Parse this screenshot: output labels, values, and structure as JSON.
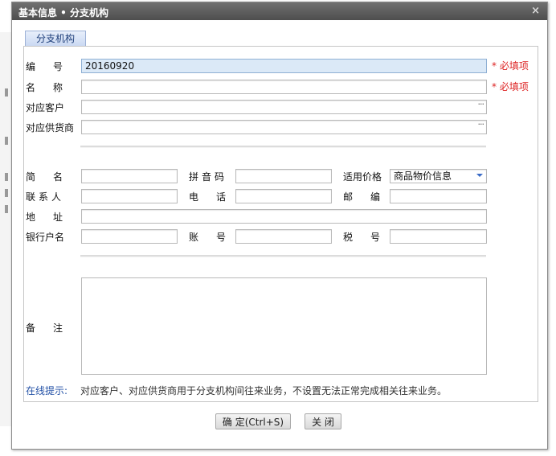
{
  "window": {
    "title": "基本信息 • 分支机构",
    "close_glyph": "×"
  },
  "tab": {
    "label": "分支机构"
  },
  "form": {
    "code": {
      "label": "编号",
      "value": "20160920",
      "required_note": "* 必填项"
    },
    "name": {
      "label": "名称",
      "value": "",
      "required_note": "* 必填项"
    },
    "customer": {
      "label": "对应客户",
      "picker_glyph": "···"
    },
    "supplier": {
      "label": "对应供货商",
      "picker_glyph": "···"
    },
    "short_name": {
      "label": "简名"
    },
    "pinyin": {
      "label": "拼音码"
    },
    "price": {
      "label": "适用价格",
      "selected": "商品物价信息"
    },
    "contact": {
      "label": "联系人"
    },
    "phone": {
      "label": "电话"
    },
    "zip": {
      "label": "邮编"
    },
    "address": {
      "label": "地址"
    },
    "bank_name": {
      "label": "银行户名"
    },
    "account": {
      "label": "账号"
    },
    "tax": {
      "label": "税号"
    },
    "remark": {
      "label": "备注"
    }
  },
  "hint": {
    "label": "在线提示:",
    "text": "对应客户、对应供货商用于分支机构间往来业务，不设置无法正常完成相关往来业务。"
  },
  "buttons": {
    "confirm": "确 定(Ctrl+S)",
    "close": "关 闭"
  }
}
